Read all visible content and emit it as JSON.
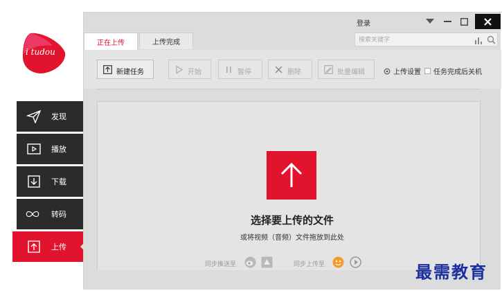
{
  "app": {
    "logo_text": "i tudou",
    "accent_color": "#e2132d"
  },
  "titlebar": {
    "login_label": "登录",
    "icons": [
      "dropdown-icon",
      "minimize-icon",
      "maximize-icon",
      "close-icon"
    ]
  },
  "search": {
    "placeholder": "搜索关键字"
  },
  "tabs": [
    {
      "label": "正在上传",
      "active": true
    },
    {
      "label": "上传完成",
      "active": false
    }
  ],
  "toolbar": {
    "new_task": "新建任务",
    "start": "开始",
    "pause": "暂停",
    "delete": "删除",
    "batch_edit": "批量编辑",
    "upload_settings": "上传设置",
    "shutdown_after": "任务完成后关机"
  },
  "sidebar": {
    "items": [
      {
        "label": "发现",
        "icon": "send-icon",
        "active": false
      },
      {
        "label": "播放",
        "icon": "play-icon",
        "active": false
      },
      {
        "label": "下载",
        "icon": "download-icon",
        "active": false
      },
      {
        "label": "转码",
        "icon": "infinity-icon",
        "active": false
      },
      {
        "label": "上传",
        "icon": "upload-icon",
        "active": true
      }
    ]
  },
  "dropzone": {
    "title": "选择要上传的文件",
    "subtitle": "或将视频（音频）文件拖放到此处"
  },
  "sync": {
    "share_label": "同步推送至",
    "upload_label": "同步上传至"
  },
  "watermark": "最需教育"
}
